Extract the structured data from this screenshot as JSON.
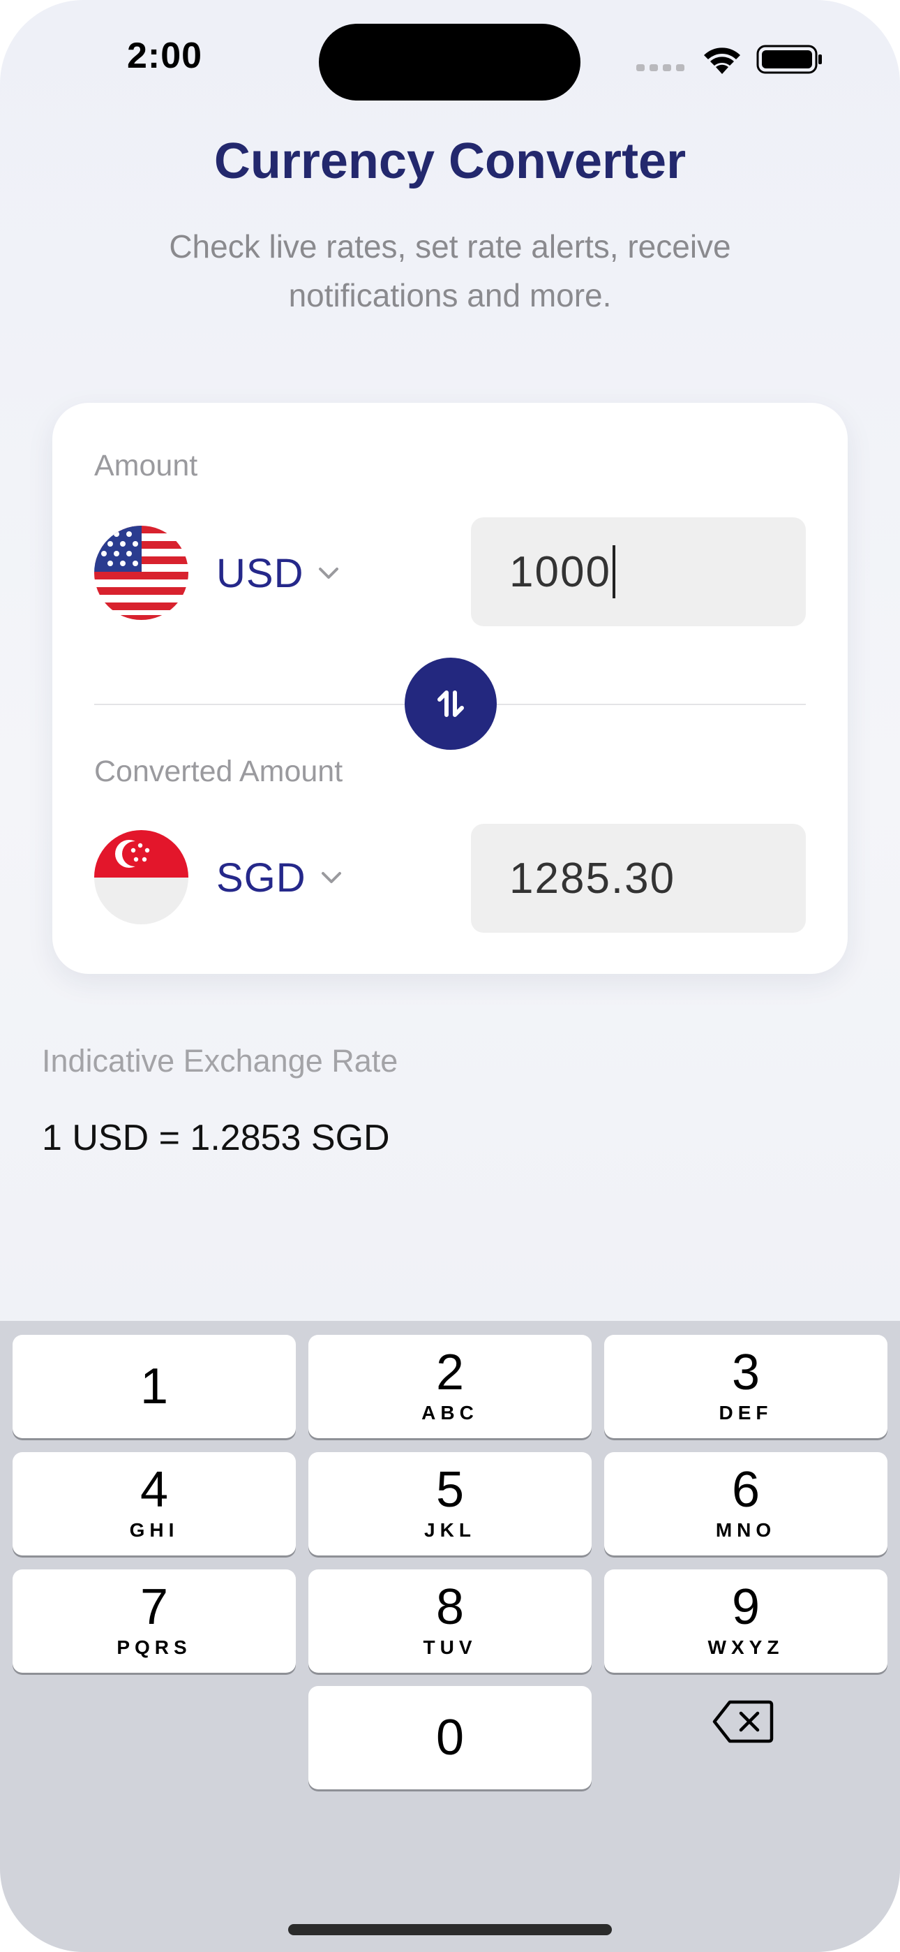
{
  "status_bar": {
    "time": "2:00",
    "icons": [
      "cellular-dots-icon",
      "wifi-icon",
      "battery-icon"
    ]
  },
  "header": {
    "title": "Currency Converter",
    "subtitle": "Check live rates, set rate alerts, receive notifications and more."
  },
  "converter": {
    "from": {
      "label": "Amount",
      "currency": "USD",
      "flag": "us-flag-icon",
      "value": "1000"
    },
    "to": {
      "label": "Converted Amount",
      "currency": "SGD",
      "flag": "sg-flag-icon",
      "value": "1285.30"
    },
    "swap_icon": "swap-arrows-icon"
  },
  "rate": {
    "label": "Indicative Exchange Rate",
    "value": "1 USD = 1.2853 SGD"
  },
  "keypad": {
    "keys": [
      {
        "digit": "1",
        "letters": ""
      },
      {
        "digit": "2",
        "letters": "ABC"
      },
      {
        "digit": "3",
        "letters": "DEF"
      },
      {
        "digit": "4",
        "letters": "GHI"
      },
      {
        "digit": "5",
        "letters": "JKL"
      },
      {
        "digit": "6",
        "letters": "MNO"
      },
      {
        "digit": "7",
        "letters": "PQRS"
      },
      {
        "digit": "8",
        "letters": "TUV"
      },
      {
        "digit": "9",
        "letters": "WXYZ"
      },
      {
        "digit": "0",
        "letters": ""
      }
    ],
    "backspace_icon": "backspace-icon"
  },
  "colors": {
    "brand": "#23286d",
    "accent": "#23287f",
    "currency_text": "#25288a"
  }
}
